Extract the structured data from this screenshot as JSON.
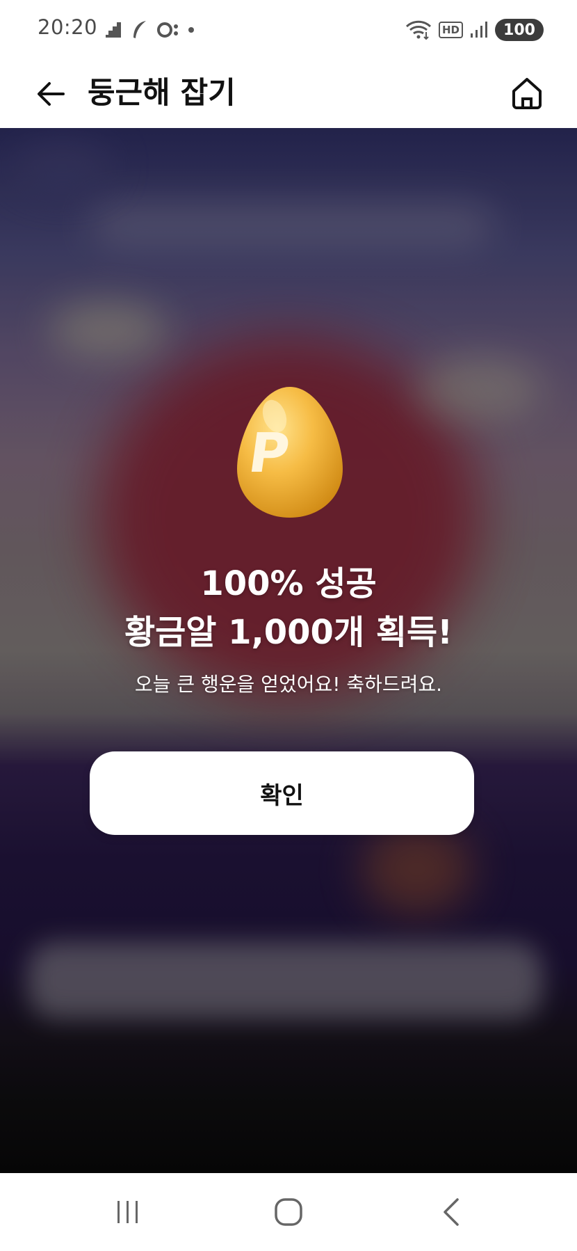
{
  "status_bar": {
    "time": "20:20",
    "battery": "100",
    "hd_label": "HD"
  },
  "header": {
    "title": "둥근해 잡기",
    "back_icon": "back-arrow-icon",
    "home_icon": "home-icon"
  },
  "result": {
    "egg_letter": "P",
    "title_line1": "100% 성공",
    "title_line2": "황금알 1,000개 획득!",
    "subtitle": "오늘 큰 행운을 얻었어요! 축하드려요.",
    "confirm_label": "확인"
  },
  "nav": {
    "recents_icon": "recents-icon",
    "home_icon": "nav-home-icon",
    "back_icon": "nav-back-icon"
  },
  "colors": {
    "egg_gold": "#f2b53a",
    "egg_highlight": "#ffe08a",
    "sun_red": "#7a1f2e",
    "button_bg": "#ffffff"
  }
}
